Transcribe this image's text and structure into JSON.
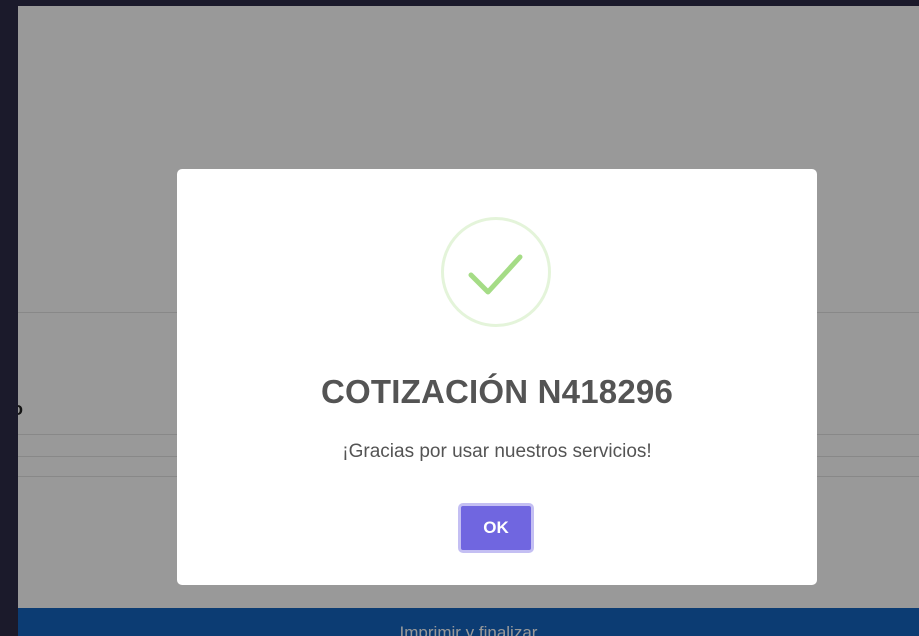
{
  "page": {
    "edge_char": "o",
    "bottom_button_label": "Imprimir y finalizar"
  },
  "dialog": {
    "icon": "success-check-icon",
    "title": "COTIZACIÓN N418296",
    "message": "¡Gracias por usar nuestros servicios!",
    "ok_label": "OK"
  },
  "colors": {
    "overlay": "rgba(0,0,0,0.4)",
    "check": "#a5dc86",
    "ok_button": "#7066e0",
    "bottom_bar": "#1565c0",
    "text": "#545454"
  }
}
